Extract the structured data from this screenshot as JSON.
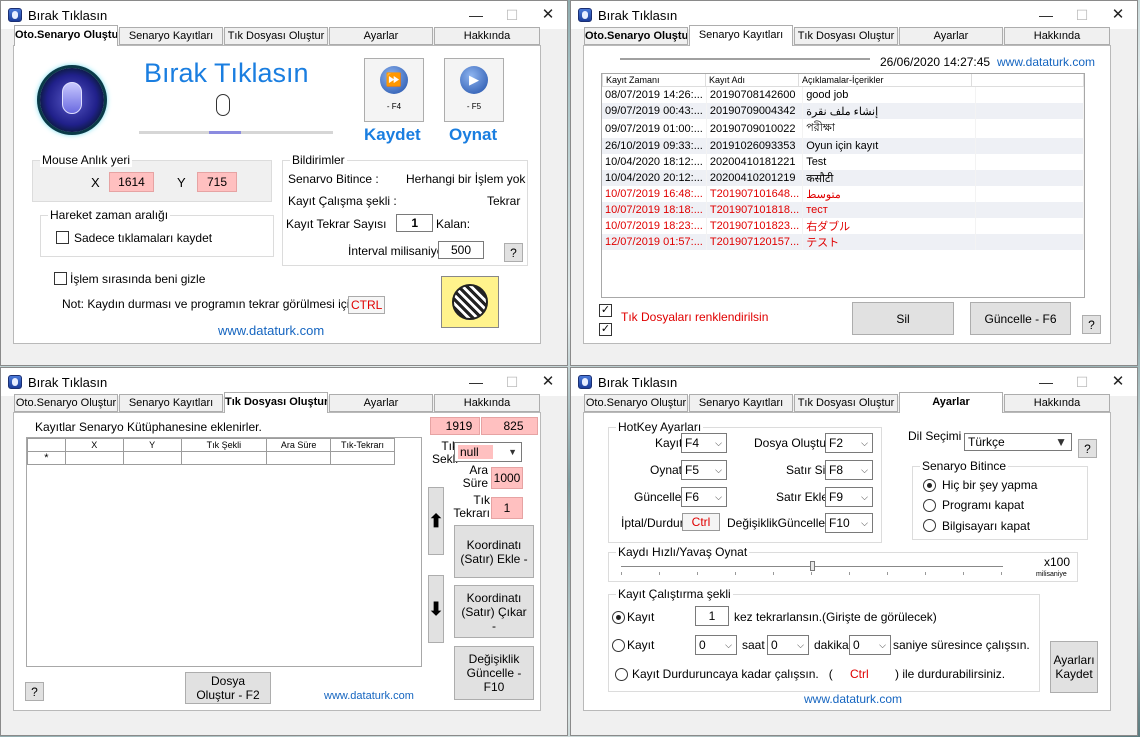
{
  "window_title": "Bırak Tıklasın",
  "window_controls": {
    "min": "—",
    "max": "☐",
    "close": "✕"
  },
  "tabs": [
    "Oto.Senaryo Oluştur",
    "Senaryo Kayıtları",
    "Tık Dosyası Oluştur",
    "Ayarlar",
    "Hakkında"
  ],
  "w1": {
    "logo_text": "Bırak Tıklasın",
    "kaydet_key": "- F4",
    "oynat_key": "- F5",
    "kaydet": "Kaydet",
    "oynat": "Oynat",
    "mouse_group": "Mouse Anlık yeri",
    "x_label": "X",
    "x_val": "1614",
    "y_label": "Y",
    "y_val": "715",
    "hareket_group": "Hareket zaman aralığı",
    "sadece": "Sadece tıklamaları kaydet",
    "gizle": "İşlem sırasında beni gizle",
    "not": "Not: Kaydın durması ve programın tekrar görülmesi için :",
    "not_key": "CTRL",
    "bildirimler": "Bildirimler",
    "bitince_l": "Senarvo Bitince :",
    "bitince_v": "Herhangi bir İşlem yok",
    "calisma_l": "Kayıt Çalışma şekli :",
    "calisma_v": "Tekrar",
    "tekrar_l": "Kayıt Tekrar Sayısı",
    "tekrar_v": "1",
    "kalan": "Kalan:",
    "interval_l": "İnterval milisaniye",
    "interval_v": "500",
    "help": "?",
    "site": "www.dataturk.com"
  },
  "w2": {
    "datetime": "26/06/2020 14:27:45",
    "site": "www.dataturk.com",
    "columns": [
      "Kayıt Zamanı",
      "Kayıt Adı",
      "Açıklamalar-İçerikler"
    ],
    "rows": [
      [
        "08/07/2019 14:26:...",
        "20190708142600",
        "good job"
      ],
      [
        "09/07/2019 00:43:...",
        "20190709004342",
        "إنشاء ملف نقرة"
      ],
      [
        "09/07/2019 01:00:...",
        "20190709010022",
        "পরীক্ষা"
      ],
      [
        "26/10/2019 09:33:...",
        "20191026093353",
        "Oyun için kayıt"
      ],
      [
        "10/04/2020 18:12:...",
        "20200410181221",
        "Test"
      ],
      [
        "10/04/2020 20:12:...",
        "20200410201219",
        "कसौटी"
      ],
      [
        "10/07/2019 16:48:...",
        "T201907101648...",
        "متوسط"
      ],
      [
        "10/07/2019 18:18:...",
        "T201907101818...",
        "тест"
      ],
      [
        "10/07/2019 18:23:...",
        "T201907101823...",
        "右ダブル"
      ],
      [
        "12/07/2019 01:57:...",
        "T201907120157...",
        "テスト"
      ]
    ],
    "red_from": 6,
    "renk": "Tık Dosyaları renklendirilsin",
    "sil": "Sil",
    "guncelle": "Güncelle - F6",
    "help": "?"
  },
  "w3": {
    "caption": "Kayıtlar Senaryo Kütüphanesine eklenirler.",
    "grid_cols": [
      "X",
      "Y",
      "Tık Şekli",
      "Ara Süre",
      "Tık-Tekrarı"
    ],
    "row_marker": "*",
    "cx_l": "X:",
    "cx": "1919",
    "cy_l": "Y:",
    "cy": "825",
    "tik_sekli_l": "Tık Sekli",
    "tik_sekli_v": "null",
    "ara_sure_l": "Ara Süre",
    "ara_sure_v": "1000",
    "tik_tekrari_l": "Tık Tekrarı",
    "tik_tekrari_v": "1",
    "ekle": "Koordinatı (Satır) Ekle -",
    "cikar": "Koordinatı (Satır) Çıkar -",
    "degisiklik": "Değişiklik Güncelle - F10",
    "dosya": "Dosya Oluştur - F2",
    "help": "?",
    "site": "www.dataturk.com"
  },
  "w4": {
    "hotkey_group": "HotKey Ayarları",
    "k_kayit": "Kayıt",
    "v_kayit": "F4",
    "k_oynat": "Oynat",
    "v_oynat": "F5",
    "k_guncelle": "Güncelle",
    "v_guncelle": "F6",
    "k_iptal": "İptal/Durdur",
    "v_iptal": "Ctrl",
    "k_dosya": "Dosya Oluştur",
    "v_dosya": "F2",
    "k_satirsil": "Satır Sil",
    "v_satirsil": "F8",
    "k_satirekle": "Satır Ekle",
    "v_satirekle": "F9",
    "k_degisiklik": "DeğişiklikGüncelle",
    "v_degisiklik": "F10",
    "dil_l": "Dil Seçimi :",
    "dil_v": "Türkçe",
    "help": "?",
    "bitince_group": "Senaryo Bitince",
    "opt1": "Hiç bir şey yapma",
    "opt2": "Programı kapat",
    "opt3": "Bilgisayarı kapat",
    "hiz_group": "Kaydı Hızlı/Yavaş Oynat",
    "hiz_v": "x100",
    "hiz_unit": "milisaniye",
    "calistirma_group": "Kayıt Çalıştırma şekli",
    "r1": "Kayıt",
    "r1_count": "1",
    "r1_text": "kez tekrarlansın.(Girişte de görülecek)",
    "r2": "Kayıt",
    "saat_v": "0",
    "saat_l": "saat",
    "dakika_v": "0",
    "dakika_l": "dakika",
    "saniye_v": "0",
    "saniye_l": "saniye süresince çalışsın.",
    "r3": "Kayıt Durduruncaya kadar çalışsın.   (",
    "r3_key": "Ctrl",
    "r3_end": ") ile durdurabilirsiniz.",
    "save": "Ayarları Kaydet",
    "site": "www.dataturk.com"
  }
}
